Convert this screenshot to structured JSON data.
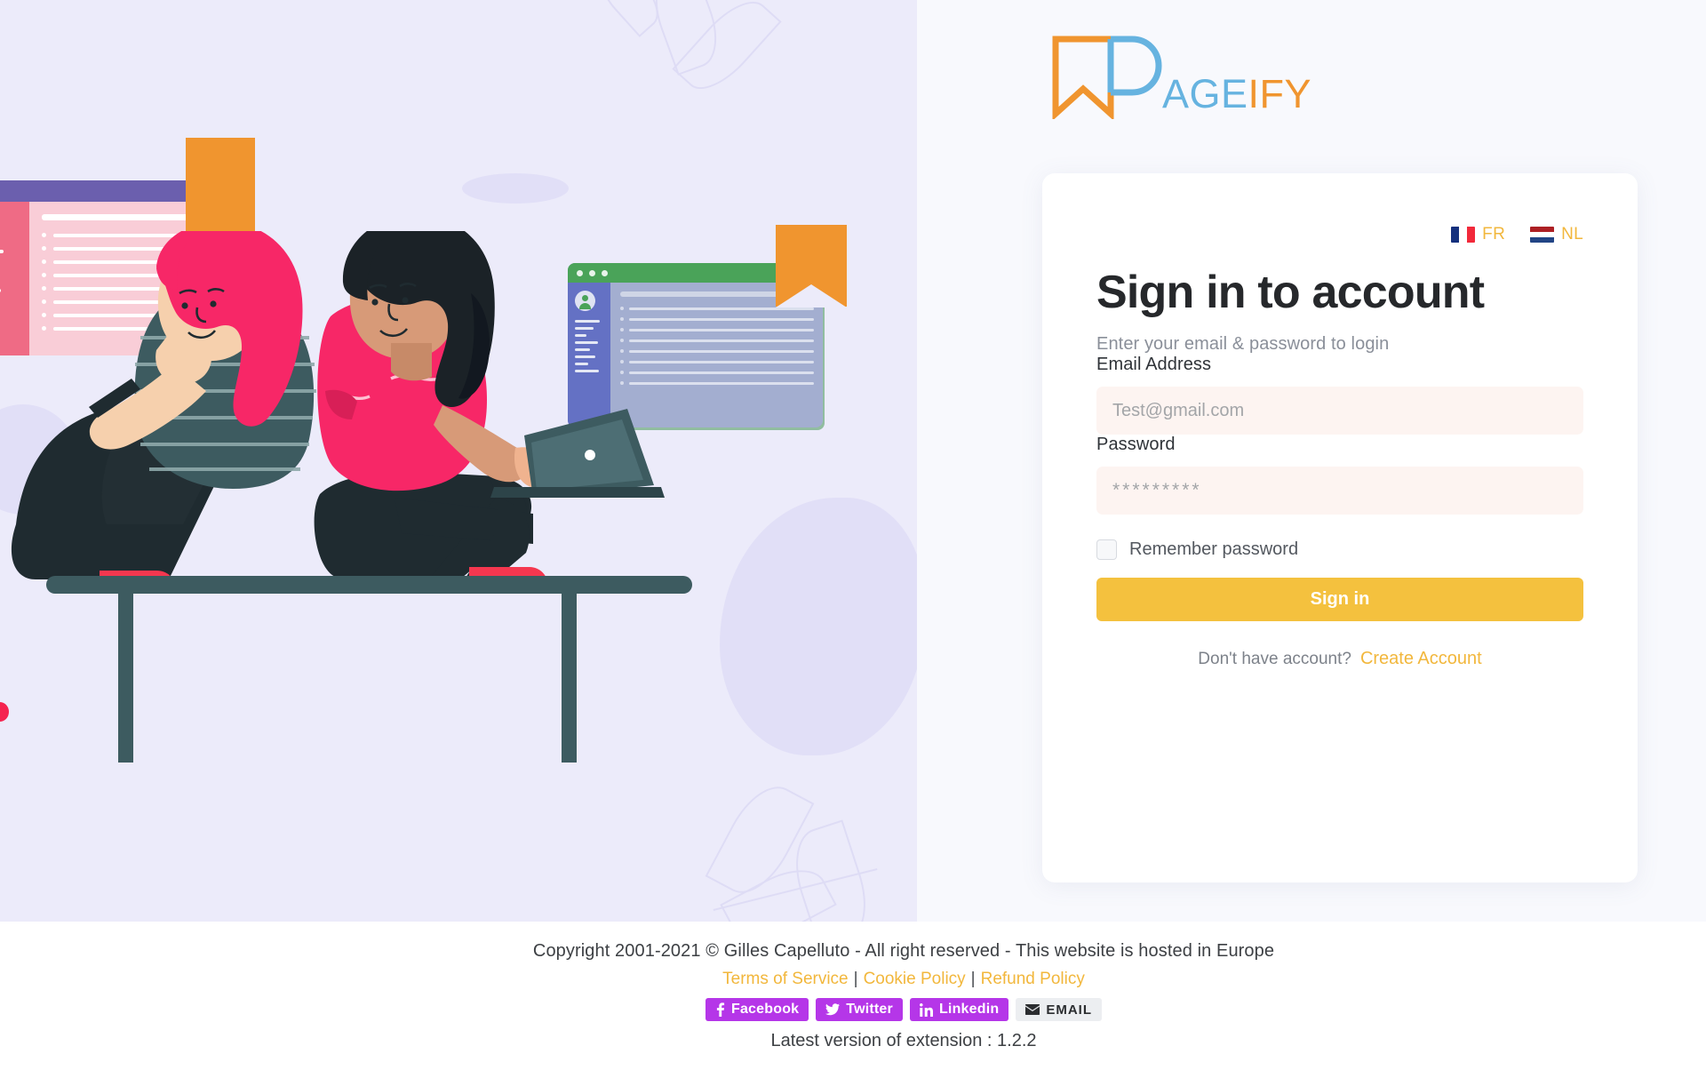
{
  "brand": {
    "logo_icon": "bookmark-p-logo-icon",
    "name_part_blue": "AGE",
    "name_part_orange": "IFY",
    "color_orange": "#f0952f",
    "color_blue": "#66b3e0"
  },
  "languages": [
    {
      "code": "FR",
      "label": "FR",
      "flag_icon": "flag-fr-icon"
    },
    {
      "code": "NL",
      "label": "NL",
      "flag_icon": "flag-nl-icon"
    }
  ],
  "card": {
    "title": "Sign in to account",
    "subtitle": "Enter your email & password to login",
    "email": {
      "label": "Email Address",
      "placeholder": "Test@gmail.com",
      "value": ""
    },
    "password": {
      "label": "Password",
      "placeholder": "*********",
      "value": ""
    },
    "remember": {
      "label": "Remember password",
      "checked": false
    },
    "submit_label": "Sign in",
    "create_prompt": "Don't have account?",
    "create_label": "Create Account",
    "accent_color": "#f4c13e",
    "link_color": "#f2b73c"
  },
  "footer": {
    "copyright": "Copyright 2001-2021 © Gilles Capelluto - All right reserved - This website is hosted in Europe",
    "links": [
      {
        "label": "Terms of Service"
      },
      {
        "label": "Cookie Policy"
      },
      {
        "label": "Refund Policy"
      }
    ],
    "separator": "|",
    "share": [
      {
        "label": "Facebook",
        "icon": "facebook-icon",
        "color": "#b536e8"
      },
      {
        "label": "Twitter",
        "icon": "twitter-icon",
        "color": "#b536e8"
      },
      {
        "label": "Linkedin",
        "icon": "linkedin-icon",
        "color": "#b536e8"
      },
      {
        "label": "EMAIL",
        "icon": "envelope-icon",
        "color": "#eceef1"
      }
    ],
    "version_text": "Latest version of extension : 1.2.2"
  },
  "illustration": {
    "alt": "Two women sitting on a bench with laptop and browser windows",
    "background_color": "#ecebfa"
  }
}
